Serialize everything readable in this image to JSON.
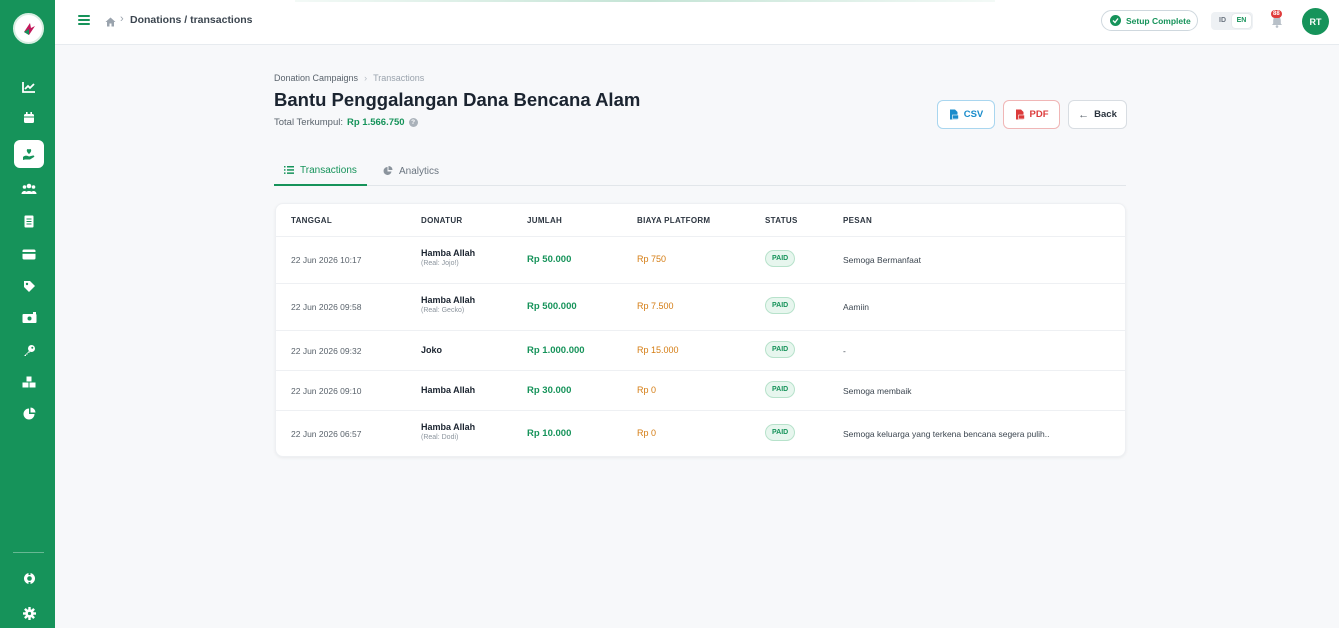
{
  "topbar": {
    "breadcrumb": "Donations / transactions",
    "setup_label": "Setup Complete",
    "lang": [
      "ID",
      "EN"
    ],
    "notification_count": "88",
    "avatar_initials": "RT"
  },
  "sidebar": {
    "items": [
      "chart-line-icon",
      "calendar-icon",
      "hand-heart-icon",
      "users-icon",
      "document-icon",
      "credit-card-icon",
      "tag-icon",
      "money-icon",
      "key-icon",
      "boxes-icon",
      "pie-chart-icon"
    ],
    "bottom": [
      "support-icon",
      "settings-icon"
    ],
    "active": "hand-heart-icon"
  },
  "page": {
    "breadcrumb_parent": "Donation Campaigns",
    "breadcrumb_current": "Transactions",
    "title": "Bantu Penggalangan Dana Bencana Alam",
    "total_label": "Total Terkumpul:",
    "total_amount": "Rp 1.566.750",
    "buttons": {
      "csv": "CSV",
      "pdf": "PDF",
      "back": "Back"
    },
    "tabs": {
      "transactions": "Transactions",
      "analytics": "Analytics"
    }
  },
  "table": {
    "headers": [
      "TANGGAL",
      "DONATUR",
      "JUMLAH",
      "BIAYA PLATFORM",
      "STATUS",
      "PESAN"
    ],
    "rows": [
      {
        "date": "22 Jun 2026 10:17",
        "donor": "Hamba Allah",
        "real": "(Real: Jojo!)",
        "amount": "Rp 50.000",
        "fee": "Rp 750",
        "status": "PAID",
        "message": "Semoga Bermanfaat"
      },
      {
        "date": "22 Jun 2026 09:58",
        "donor": "Hamba Allah",
        "real": "(Real: Gecko)",
        "amount": "Rp 500.000",
        "fee": "Rp 7.500",
        "status": "PAID",
        "message": "Aamiin"
      },
      {
        "date": "22 Jun 2026 09:32",
        "donor": "Joko",
        "real": "",
        "amount": "Rp 1.000.000",
        "fee": "Rp 15.000",
        "status": "PAID",
        "message": "-"
      },
      {
        "date": "22 Jun 2026 09:10",
        "donor": "Hamba Allah",
        "real": "",
        "amount": "Rp 30.000",
        "fee": "Rp 0",
        "status": "PAID",
        "message": "Semoga membaik"
      },
      {
        "date": "22 Jun 2026 06:57",
        "donor": "Hamba Allah",
        "real": "(Real: Dodi)",
        "amount": "Rp 10.000",
        "fee": "Rp 0",
        "status": "PAID",
        "message": "Semoga keluarga yang terkena bencana segera pulih.."
      }
    ]
  },
  "colors": {
    "brand": "#16935a",
    "fee": "#d47c12",
    "pdf": "#dc3b3b",
    "csv": "#1a8ccb"
  }
}
